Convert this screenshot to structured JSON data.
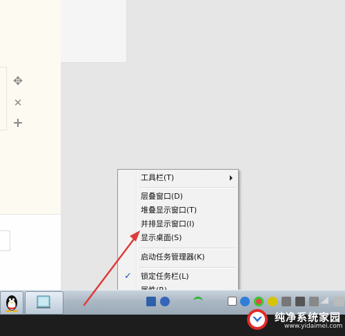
{
  "context_menu": {
    "items": [
      {
        "label": "工具栏(T)",
        "has_submenu": true,
        "checked": false
      },
      {
        "label": "层叠窗口(D)",
        "has_submenu": false,
        "checked": false
      },
      {
        "label": "堆叠显示窗口(T)",
        "has_submenu": false,
        "checked": false
      },
      {
        "label": "并排显示窗口(I)",
        "has_submenu": false,
        "checked": false
      },
      {
        "label": "显示桌面(S)",
        "has_submenu": false,
        "checked": false
      },
      {
        "label": "启动任务管理器(K)",
        "has_submenu": false,
        "checked": false
      },
      {
        "label": "锁定任务栏(L)",
        "has_submenu": false,
        "checked": true
      },
      {
        "label": "属性(R)",
        "has_submenu": false,
        "checked": false
      }
    ]
  },
  "watermark": {
    "title": "纯净系统家园",
    "url": "www.yidaimei.com"
  },
  "colors": {
    "arrow": "#e03a3a",
    "taskbar": "#aab7c4",
    "menu_bg": "#f2f2f2",
    "check": "#1f4fb3"
  },
  "icons": {
    "move": "move-icon",
    "close": "close-icon",
    "add": "plus-icon"
  }
}
